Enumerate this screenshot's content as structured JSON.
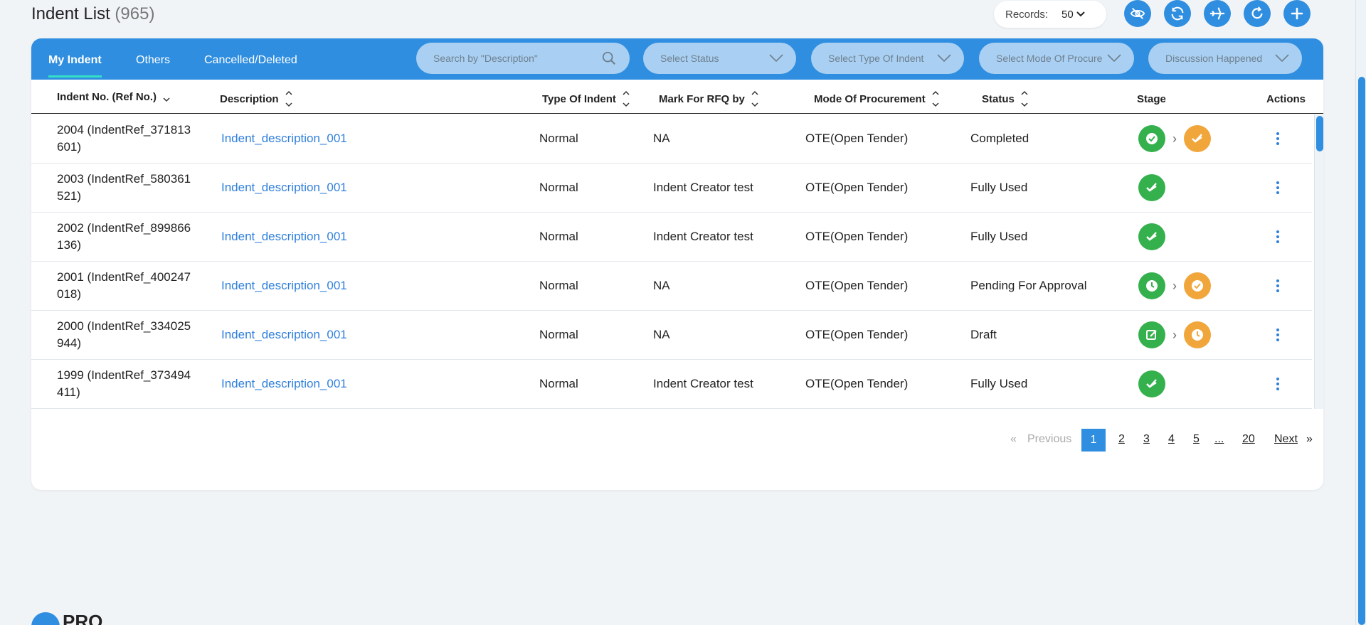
{
  "header": {
    "title": "Indent List",
    "count": "(965)",
    "records_label": "Records:",
    "records_value": "50"
  },
  "tabs": [
    {
      "label": "My Indent",
      "active": true
    },
    {
      "label": "Others",
      "active": false
    },
    {
      "label": "Cancelled/Deleted",
      "active": false
    }
  ],
  "filters": {
    "search_placeholder": "Search by \"Description\"",
    "status": "Select Status",
    "type": "Select Type Of Indent",
    "mode": "Select Mode Of Procure",
    "discussion": "Discussion Happened"
  },
  "columns": {
    "ref": "Indent No. (Ref No.)",
    "desc": "Description",
    "type": "Type Of Indent",
    "rfq": "Mark For RFQ by",
    "mode": "Mode Of Procurement",
    "status": "Status",
    "stage": "Stage",
    "actions": "Actions"
  },
  "rows": [
    {
      "ref": "2004 (IndentRef_371813 601)",
      "desc": "Indent_description_001",
      "type": "Normal",
      "rfq": "NA",
      "mode": "OTE(Open Tender)",
      "status": "Completed",
      "stage": [
        "check-circle",
        "check-double"
      ]
    },
    {
      "ref": "2003 (IndentRef_580361 521)",
      "desc": "Indent_description_001",
      "type": "Normal",
      "rfq": "Indent Creator test",
      "mode": "OTE(Open Tender)",
      "status": "Fully Used",
      "stage": [
        "check-double"
      ]
    },
    {
      "ref": "2002 (IndentRef_899866 136)",
      "desc": "Indent_description_001",
      "type": "Normal",
      "rfq": "Indent Creator test",
      "mode": "OTE(Open Tender)",
      "status": "Fully Used",
      "stage": [
        "check-double"
      ]
    },
    {
      "ref": "2001 (IndentRef_400247 018)",
      "desc": "Indent_description_001",
      "type": "Normal",
      "rfq": "NA",
      "mode": "OTE(Open Tender)",
      "status": "Pending For Approval",
      "stage": [
        "clock",
        "check-circle"
      ]
    },
    {
      "ref": "2000 (IndentRef_334025 944)",
      "desc": "Indent_description_001",
      "type": "Normal",
      "rfq": "NA",
      "mode": "OTE(Open Tender)",
      "status": "Draft",
      "stage": [
        "edit",
        "clock"
      ]
    },
    {
      "ref": "1999 (IndentRef_373494 411)",
      "desc": "Indent_description_001",
      "type": "Normal",
      "rfq": "Indent Creator test",
      "mode": "OTE(Open Tender)",
      "status": "Fully Used",
      "stage": [
        "check-double"
      ]
    }
  ],
  "pagination": {
    "first": "«",
    "previous": "Previous",
    "pages": [
      "1",
      "2",
      "3",
      "4",
      "5",
      "...",
      "20"
    ],
    "current": "1",
    "next": "Next",
    "last": "»"
  },
  "brand": {
    "text": "PRO"
  },
  "colors": {
    "accent": "#2f8ee0",
    "green": "#34b04d",
    "orange": "#f0a63a",
    "link": "#2f7fdc"
  }
}
